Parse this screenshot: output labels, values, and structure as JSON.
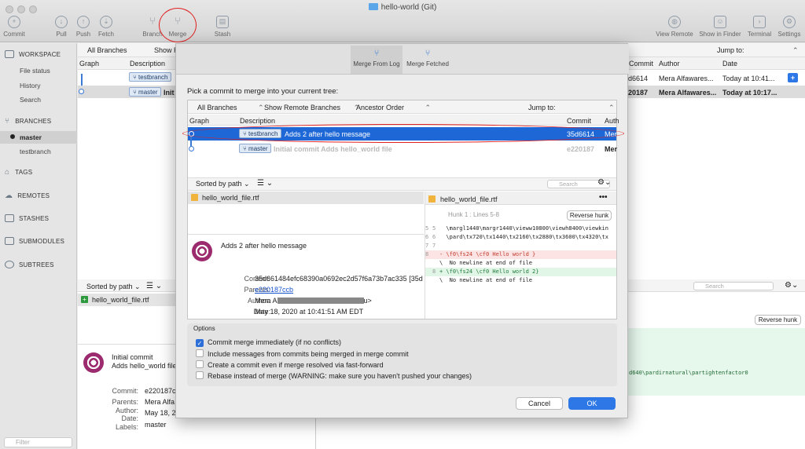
{
  "window": {
    "title": "hello-world (Git)"
  },
  "toolbar": {
    "commit": "Commit",
    "pull": "Pull",
    "push": "Push",
    "fetch": "Fetch",
    "branch": "Branch",
    "merge": "Merge",
    "stash": "Stash",
    "view_remote": "View Remote",
    "show_in_finder": "Show in Finder",
    "terminal": "Terminal",
    "settings": "Settings"
  },
  "sidebar": {
    "workspace": "WORKSPACE",
    "file_status": "File status",
    "history": "History",
    "search": "Search",
    "branches": "BRANCHES",
    "master": "master",
    "testbranch": "testbranch",
    "tags": "TAGS",
    "remotes": "REMOTES",
    "stashes": "STASHES",
    "submodules": "SUBMODULES",
    "subtrees": "SUBTREES",
    "filter_placeholder": "Filter"
  },
  "main": {
    "all_branches": "All Branches",
    "show": "Show R",
    "graph": "Graph",
    "description": "Description",
    "commit": "Commit",
    "author": "Author",
    "date": "Date",
    "jump_to": "Jump to:",
    "rows": [
      {
        "branch": "testbranch",
        "commit": "d6614",
        "author": "Mera Alfawares...",
        "date": "Today at 10:41..."
      },
      {
        "branch": "master",
        "desc": "Init",
        "commit": "20187",
        "author": "Mera Alfawares...",
        "date": "Today at 10:17..."
      }
    ],
    "sorted_by_path": "Sorted by path",
    "file": "hello_world_file.rtf",
    "detail_msg1": "Initial commit",
    "detail_msg2": "Adds hello_world file",
    "commit_label": "Commit:",
    "commit_value": "e220187c",
    "parents_label": "Parents:",
    "parents_value": "Mera Alfa",
    "author_label": "Author:",
    "author_value": "May 18, 2",
    "date_label": "Date:",
    "labels_label": "Labels:",
    "labels_value": "master",
    "search_placeholder": "Search",
    "reverse_hunk": "Reverse hunk",
    "diff_tail": "d640\\pardirnatural\\partightenfactor0"
  },
  "modal": {
    "tab_merge_from_log": "Merge From Log",
    "tab_merge_fetched": "Merge Fetched",
    "prompt": "Pick a commit to merge into your current tree:",
    "all_branches": "All Branches",
    "show_remote": "Show Remote Branches",
    "ancestor": "Ancestor Order",
    "jump_to": "Jump to:",
    "col_graph": "Graph",
    "col_desc": "Description",
    "col_commit": "Commit",
    "col_author": "Auth",
    "row1": {
      "branch": "testbranch",
      "desc": "Adds 2 after hello message",
      "commit": "35d6614",
      "author": "Mer"
    },
    "row2": {
      "branch": "master",
      "desc": "Initial commit Adds hello_world file",
      "commit": "e220187",
      "author": "Mer"
    },
    "sorted_by_path": "Sorted by path",
    "search_placeholder": "Search",
    "file": "hello_world_file.rtf",
    "diff_file": "hello_world_file.rtf",
    "hunk": "Hunk 1 : Lines 5-8",
    "reverse_hunk": "Reverse hunk",
    "diff": [
      {
        "a": "5",
        "b": "5",
        "text": "  \\margl1440\\margr1440\\vieww10800\\viewh8400\\viewkin"
      },
      {
        "a": "6",
        "b": "6",
        "text": "  \\pard\\tx720\\tx1440\\tx2160\\tx2880\\tx3600\\tx4320\\tx"
      },
      {
        "a": "7",
        "b": "7",
        "text": ""
      },
      {
        "a": "8",
        "b": "",
        "text": "- \\f0\\fs24 \\cf0 Hello world }"
      },
      {
        "a": "",
        "b": "",
        "text": "\\  No newline at end of file"
      },
      {
        "a": "",
        "b": "8",
        "text": "+ \\f0\\fs24 \\cf0 Hello world 2}"
      },
      {
        "a": "",
        "b": "",
        "text": "\\  No newline at end of file"
      }
    ],
    "detail_message": "Adds 2 after hello message",
    "commit_label": "Commit:",
    "commit_value": "35d661484efc68390a0692ec2d57f6a73b7ac335 [35d",
    "parents_label": "Parents:",
    "parents_value": "e220187ccb",
    "author_label": "Author:",
    "author_prefix": "Mera A",
    "author_suffix": "u>",
    "date_label": "Date:",
    "date_value": "May 18, 2020 at 10:41:51 AM EDT",
    "options_title": "Options",
    "opt1": "Commit merge immediately (if no conflicts)",
    "opt2": "Include messages from commits being merged in merge commit",
    "opt3": "Create a commit even if merge resolved via fast-forward",
    "opt4": "Rebase instead of merge (WARNING: make sure you haven't pushed your changes)",
    "cancel": "Cancel",
    "ok": "OK"
  }
}
